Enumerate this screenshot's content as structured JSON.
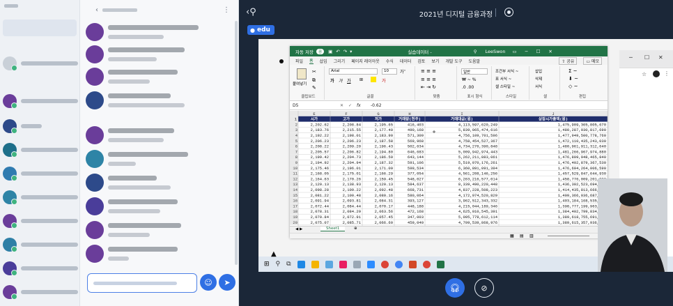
{
  "header": {
    "title": "2021년 디지털 금융과정",
    "room": "edu"
  },
  "excel": {
    "autosave": "자동 저장",
    "autosave_state": "끔",
    "filename": "실습데이터 -",
    "user": "LeeSwon",
    "tabs": [
      "파일",
      "홈",
      "삽입",
      "그리기",
      "페이지 레이아웃",
      "수식",
      "데이터",
      "검토",
      "보기",
      "개발 도구",
      "도움말"
    ],
    "share": "공유",
    "memo": "메모",
    "font_name": "Arial",
    "font_size": "10",
    "number_format": "일반",
    "paste_label": "붙여넣기",
    "ribbon_groups": [
      "클립보드",
      "글꼴",
      "맞춤",
      "표시 형식",
      "스타일",
      "셀",
      "편집"
    ],
    "styles_items": [
      "조건부 서식 ~",
      "표 서식 ~",
      "셀 스타일 ~"
    ],
    "cells_items": [
      "삽입",
      "삭제",
      "서식"
    ],
    "name_box": "D5",
    "fx": "fx",
    "formula_value": "-0.62",
    "columns": [
      "E",
      "F",
      "G",
      "H",
      "I",
      "J"
    ],
    "headers": [
      "시가",
      "고가",
      "저가",
      "거래량(천주)",
      "거래대금(원)",
      "상장시가총액(원)"
    ],
    "rows": [
      [
        "2",
        "2,202.62",
        "2,208.84",
        "2,195.65",
        "416,403",
        "4,113,597,620,249",
        "1,475,909,365,805,670"
      ],
      [
        "3",
        "2,183.76",
        "2,215.55",
        "2,177.40",
        "490,168",
        "5,839,065,474,616",
        "1,480,287,930,817,690"
      ],
      [
        "4",
        "2,192.22",
        "2,198.01",
        "2,183.90",
        "571,309",
        "4,756,109,701,596",
        "1,477,949,500,778,760"
      ],
      [
        "5",
        "2,206.23",
        "2,206.23",
        "2,187.58",
        "569,968",
        "4,758,454,527,367",
        "1,472,110,435,243,030"
      ],
      [
        "6",
        "2,208.22",
        "2,209.20",
        "2,196.43",
        "502,634",
        "4,734,276,390,848",
        "1,480,961,911,312,640"
      ],
      [
        "7",
        "2,205.57",
        "2,206.82",
        "2,194.80",
        "646,683",
        "5,009,942,974,443",
        "1,481,266,967,974,880"
      ],
      [
        "8",
        "2,199.42",
        "2,204.73",
        "2,186.59",
        "643,144",
        "5,262,211,883,061",
        "1,476,809,948,465,840"
      ],
      [
        "9",
        "2,194.92",
        "2,204.94",
        "2,187.32",
        "591,106",
        "5,519,070,176,261",
        "1,476,402,879,367,530"
      ],
      [
        "10",
        "2,175.46",
        "2,196.01",
        "2,171.09",
        "599,534",
        "6,360,891,091,394",
        "1,476,694,264,006,590"
      ],
      [
        "11",
        "2,168.05",
        "2,175.01",
        "2,166.29",
        "377,054",
        "4,561,208,146,256",
        "1,457,529,847,644,930"
      ],
      [
        "12",
        "2,164.63",
        "2,170.26",
        "2,159.45",
        "548,027",
        "6,263,216,577,014",
        "1,458,776,009,201,290"
      ],
      [
        "13",
        "2,120.13",
        "2,138.93",
        "2,120.13",
        "584,637",
        "8,339,490,220,448",
        "1,436,302,523,694,510"
      ],
      [
        "14",
        "2,098.28",
        "2,109.22",
        "2,092.48",
        "668,731",
        "4,837,228,508,223",
        "1,414,435,813,666,680"
      ],
      [
        "15",
        "2,081.22",
        "2,100.48",
        "2,080.16",
        "580,064",
        "4,172,974,520,829",
        "1,409,366,036,687,660"
      ],
      [
        "16",
        "2,091.94",
        "2,093.81",
        "2,084.31",
        "393,127",
        "3,962,512,343,332",
        "1,403,184,168,535,180"
      ],
      [
        "17",
        "2,072.44",
        "2,084.44",
        "2,070.17",
        "448,188",
        "4,215,044,189,346",
        "1,398,777,199,963,670"
      ],
      [
        "18",
        "2,078.31",
        "2,084.29",
        "2,063.56",
        "472,168",
        "4,625,010,545,391",
        "1,384,402,799,834,150"
      ],
      [
        "19",
        "2,070.84",
        "2,072.91",
        "2,057.45",
        "347,003",
        "5,095,778,612,114",
        "1,389,618,755,691,820"
      ],
      [
        "20",
        "2,075.07",
        "2,085.71",
        "2,066.60",
        "459,040",
        "4,709,539,868,976",
        "1,389,615,357,936,730"
      ]
    ],
    "sheet_tab": "Sheet1"
  },
  "colors": {
    "excel_green": "#217346",
    "accent_blue": "#2f6fe4",
    "main_bg": "#1b2738"
  },
  "icons": {
    "back": "back-icon",
    "record": "record-icon",
    "headset": "headset-icon",
    "camera_off": "camera-off-icon"
  }
}
